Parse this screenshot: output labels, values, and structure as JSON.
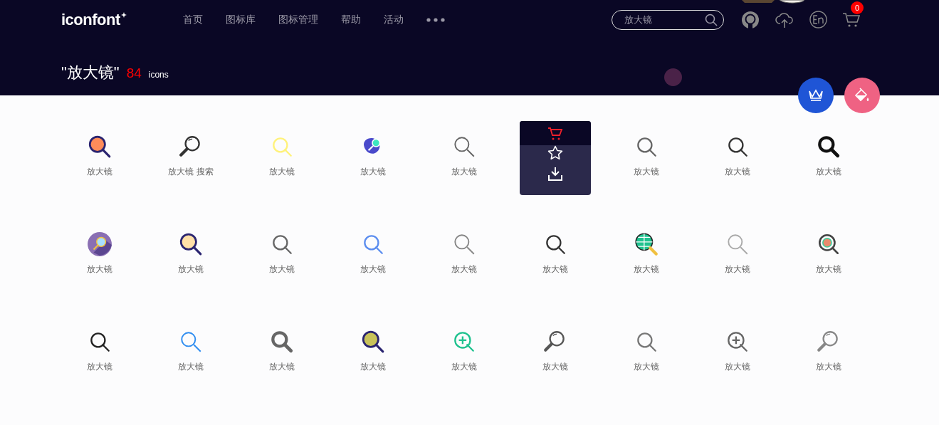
{
  "header": {
    "logo": "iconfont",
    "nav": [
      {
        "label": "首页",
        "selected": false
      },
      {
        "label": "图标库",
        "selected": false
      },
      {
        "label": "图标管理",
        "selected": false
      },
      {
        "label": "帮助",
        "selected": false
      },
      {
        "label": "活动",
        "selected": false
      }
    ],
    "search": {
      "value": "放大镜"
    },
    "cart_count": "0"
  },
  "result": {
    "query": "\"放大镜\"",
    "count": "84",
    "unit": "icons"
  },
  "icons": [
    {
      "label": "放大镜",
      "kind": "filled",
      "color": "#ff8c5a",
      "hovered": false
    },
    {
      "label": "放大镜 搜索",
      "kind": "loupe",
      "color": "#333333",
      "hovered": false
    },
    {
      "label": "放大镜",
      "kind": "outline",
      "color": "#fff27a",
      "hovered": false
    },
    {
      "label": "放大镜",
      "kind": "blob",
      "color": "#4a4acb",
      "hovered": false
    },
    {
      "label": "放大镜",
      "kind": "thin",
      "color": "#666666",
      "hovered": false
    },
    {
      "hovered": true
    },
    {
      "label": "放大镜",
      "kind": "outline",
      "color": "#666666",
      "hovered": false
    },
    {
      "label": "放大镜",
      "kind": "outline",
      "color": "#333333",
      "hovered": false
    },
    {
      "label": "放大镜",
      "kind": "bold",
      "color": "#111111",
      "hovered": false
    },
    {
      "label": "放大镜",
      "kind": "round",
      "color": "#8a6fb3",
      "hovered": false
    },
    {
      "label": "放大镜",
      "kind": "filled",
      "color": "#ffe0a8",
      "hovered": false
    },
    {
      "label": "放大镜",
      "kind": "outline",
      "color": "#666666",
      "hovered": false
    },
    {
      "label": "放大镜",
      "kind": "outline",
      "color": "#5b8def",
      "hovered": false
    },
    {
      "label": "放大镜",
      "kind": "thin",
      "color": "#888888",
      "hovered": false
    },
    {
      "label": "放大镜",
      "kind": "outline",
      "color": "#333333",
      "hovered": false
    },
    {
      "label": "放大镜",
      "kind": "globe",
      "color": "#1fc28f",
      "hovered": false
    },
    {
      "label": "放大镜",
      "kind": "thin",
      "color": "#aaaaaa",
      "hovered": false
    },
    {
      "label": "放大镜",
      "kind": "target",
      "color": "#444444",
      "hovered": false
    },
    {
      "label": "放大镜",
      "kind": "outline",
      "color": "#222222",
      "hovered": false
    },
    {
      "label": "放大镜",
      "kind": "thin",
      "color": "#2d8cf0",
      "hovered": false
    },
    {
      "label": "放大镜",
      "kind": "bold",
      "color": "#666666",
      "hovered": false
    },
    {
      "label": "放大镜",
      "kind": "filled",
      "color": "#c8c25a",
      "hovered": false
    },
    {
      "label": "放大镜",
      "kind": "plus",
      "color": "#1fc28f",
      "hovered": false
    },
    {
      "label": "放大镜",
      "kind": "loupe",
      "color": "#555555",
      "hovered": false
    },
    {
      "label": "放大镜",
      "kind": "outline",
      "color": "#777777",
      "hovered": false
    },
    {
      "label": "放大镜",
      "kind": "plus",
      "color": "#666666",
      "hovered": false
    },
    {
      "label": "放大镜",
      "kind": "loupe",
      "color": "#888888",
      "hovered": false
    }
  ]
}
